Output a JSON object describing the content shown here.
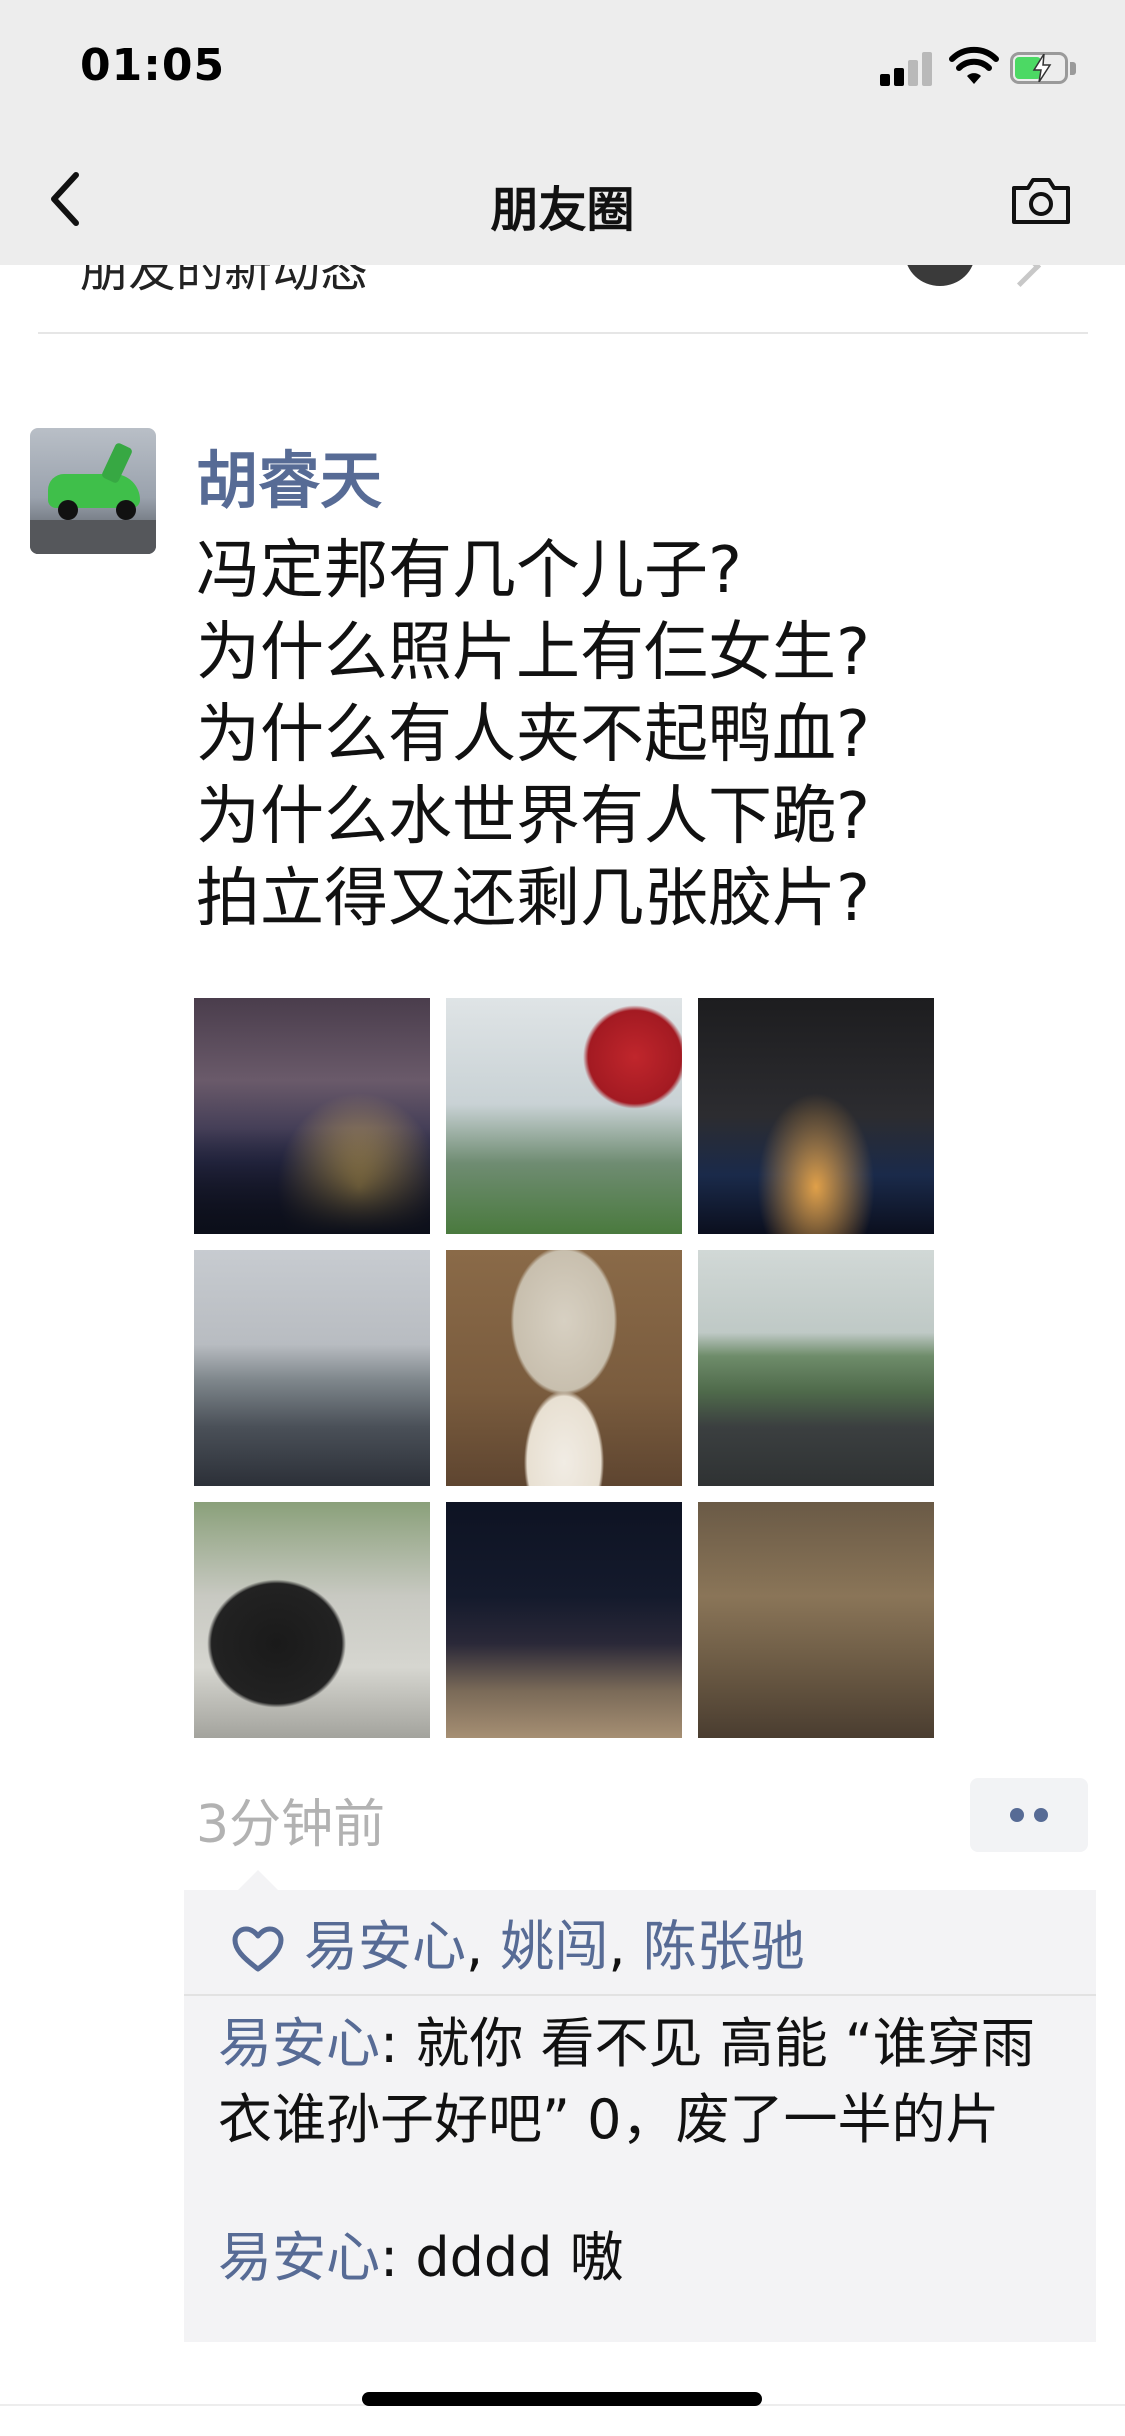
{
  "status_bar": {
    "time": "01:05"
  },
  "nav": {
    "title": "朋友圈"
  },
  "header_remnant": {
    "text": "朋友的新动态"
  },
  "post": {
    "author": "胡睿天",
    "lines": [
      "冯定邦有几个儿子?",
      "为什么照片上有仨女生?",
      "为什么有人夹不起鸭血?",
      "为什么水世界有人下跪?",
      "拍立得又还剩几张胶片?"
    ],
    "photo_count": 9,
    "time_ago": "3分钟前"
  },
  "likes": {
    "names": [
      "易安心",
      "姚闯",
      "陈张驰"
    ],
    "separator": ", "
  },
  "comments": [
    {
      "author": "易安心",
      "colon": ": ",
      "text": "就你 看不见 高能 “谁穿雨衣谁孙子好吧” 0，废了一半的片"
    },
    {
      "author": "易安心",
      "colon": ": ",
      "text": "dddd 嗷"
    }
  ],
  "colors": {
    "link_blue": "#576b95",
    "nav_bg": "#ededed",
    "meta_gray": "#b2b2b2"
  },
  "icons": {
    "back": "chevron-left-icon",
    "camera": "camera-icon",
    "like": "heart-icon",
    "more": "more-dots-icon"
  }
}
